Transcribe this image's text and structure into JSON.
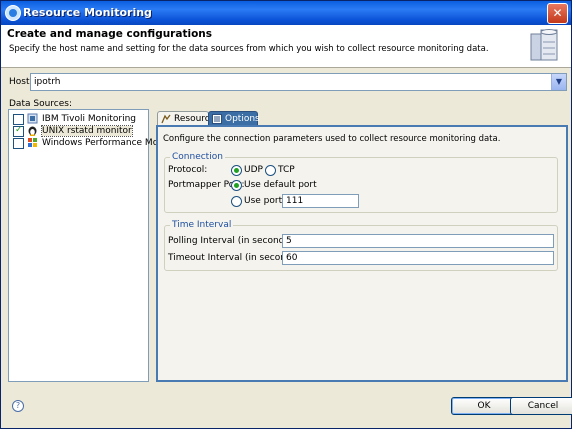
{
  "window": {
    "title": "Resource Monitoring"
  },
  "header": {
    "title": "Create and manage configurations",
    "description": "Specify the host name and setting for the data sources from which you wish to collect resource monitoring data."
  },
  "host": {
    "label": "Host:",
    "value": "ipotrh"
  },
  "data_sources": {
    "label": "Data Sources:",
    "items": [
      {
        "label": "IBM Tivoli Monitoring",
        "checked": false,
        "icon": "tivoli-icon"
      },
      {
        "label": "UNIX rstatd monitor",
        "checked": true,
        "icon": "unix-icon",
        "selected": true
      },
      {
        "label": "Windows Performance Monitor",
        "checked": false,
        "icon": "windows-icon"
      }
    ]
  },
  "tabs": [
    {
      "label": "Resource",
      "active": false
    },
    {
      "label": "Options",
      "active": true
    }
  ],
  "options": {
    "description": "Configure the connection parameters used to collect resource monitoring data.",
    "connection": {
      "legend": "Connection",
      "protocol_label": "Protocol:",
      "protocol_udp": "UDP",
      "protocol_tcp": "TCP",
      "protocol_selected": "UDP",
      "portmapper_label": "Portmapper Port:",
      "use_default_port": "Use default port",
      "use_port": "Use port:",
      "port_value": "111",
      "port_selected": "default"
    },
    "time_interval": {
      "legend": "Time Interval",
      "polling_label": "Polling Interval (in seconds):",
      "polling_value": "5",
      "timeout_label": "Timeout Interval (in seconds):",
      "timeout_value": "60"
    }
  },
  "footer": {
    "help_icon": "?",
    "ok": "OK",
    "cancel": "Cancel"
  }
}
